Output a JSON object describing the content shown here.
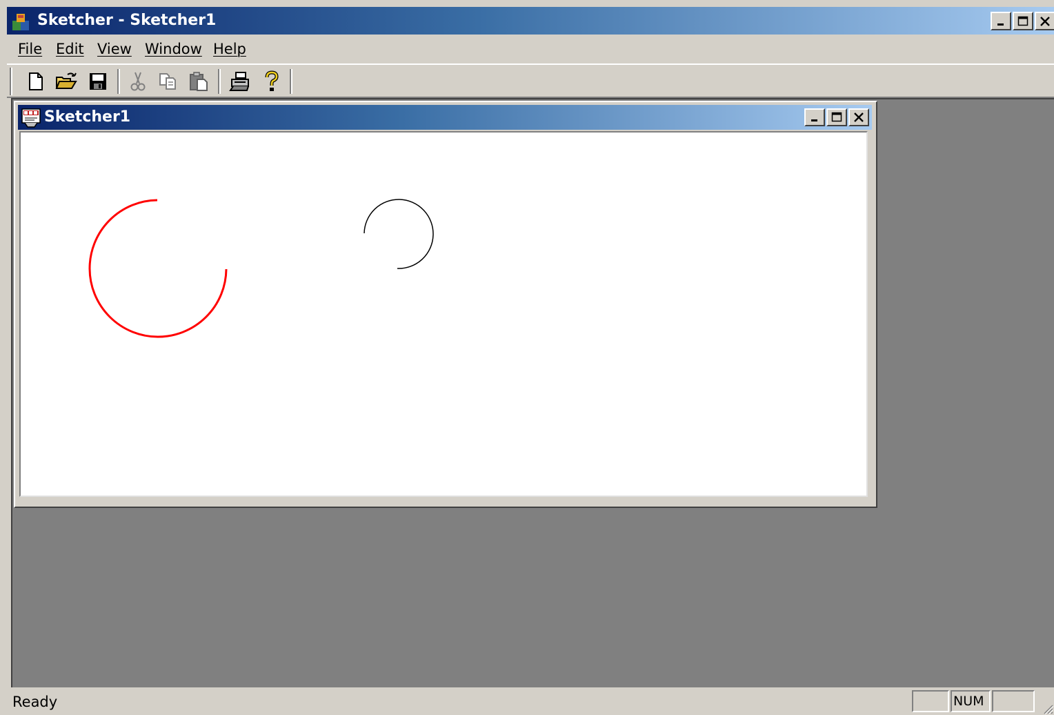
{
  "app": {
    "title": "Sketcher - Sketcher1"
  },
  "menu": {
    "items": [
      "File",
      "Edit",
      "View",
      "Window",
      "Help"
    ]
  },
  "toolbar": {
    "buttons": [
      "new-icon",
      "open-icon",
      "save-icon",
      "cut-icon",
      "copy-icon",
      "paste-icon",
      "print-icon",
      "help-icon"
    ]
  },
  "document": {
    "title": "Sketcher1",
    "shapes": [
      {
        "type": "arc",
        "color": "#ff0000",
        "label": "red-arc"
      },
      {
        "type": "arc",
        "color": "#000000",
        "label": "black-arc"
      }
    ]
  },
  "status": {
    "text": "Ready",
    "indicators": [
      "",
      "NUM",
      ""
    ]
  },
  "colors": {
    "titlebar_start": "#0a246a",
    "titlebar_end": "#a6caf0",
    "mdi_background": "#808080",
    "face": "#d4d0c8"
  }
}
